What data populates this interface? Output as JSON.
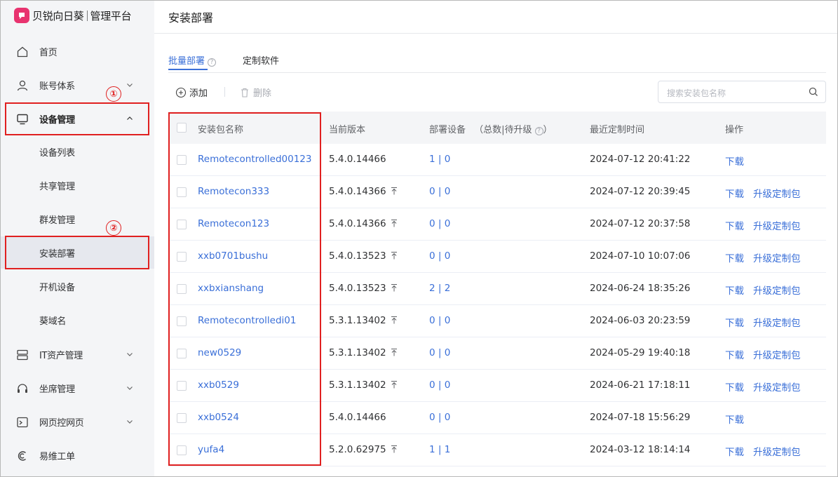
{
  "colors": {
    "accent": "#3a6fd8",
    "brand": "#e8336f",
    "annotation": "#e02020"
  },
  "logo": {
    "brand": "贝锐向日葵",
    "product": "管理平台"
  },
  "sidebar": {
    "items": [
      {
        "label": "首页",
        "icon": "home-icon"
      },
      {
        "label": "账号体系",
        "icon": "user-icon"
      },
      {
        "label": "设备管理",
        "icon": "monitor-icon"
      },
      {
        "label": "IT资产管理",
        "icon": "server-icon"
      },
      {
        "label": "坐席管理",
        "icon": "headset-icon"
      },
      {
        "label": "网页控网页",
        "icon": "terminal-icon"
      },
      {
        "label": "易维工单",
        "icon": "ticket-icon"
      }
    ],
    "device_sub": [
      "设备列表",
      "共享管理",
      "群发管理",
      "安装部署",
      "开机设备",
      "葵域名"
    ]
  },
  "annotations": {
    "first": "①",
    "second": "②"
  },
  "header": {
    "title": "安装部署"
  },
  "tabs": [
    {
      "label": "批量部署",
      "help": "?"
    },
    {
      "label": "定制软件"
    }
  ],
  "toolbar": {
    "add": "添加",
    "delete": "删除",
    "search_placeholder": "搜索安装包名称"
  },
  "table": {
    "headers": {
      "name": "安装包名称",
      "version": "当前版本",
      "devices": "部署设备",
      "devices_hint": "（总数|待升级",
      "devices_hint_end": "）",
      "help": "?",
      "time": "最近定制时间",
      "action": "操作"
    },
    "rows": [
      {
        "name": "Remotecontrolled00123",
        "version": "5.4.0.14466",
        "upgradable": false,
        "devices": "1 | 0",
        "time": "2024-07-12 20:41:22",
        "download": "下载",
        "upgrade": ""
      },
      {
        "name": "Remotecon333",
        "version": "5.4.0.14366",
        "upgradable": true,
        "devices": "0 | 0",
        "time": "2024-07-12 20:39:45",
        "download": "下载",
        "upgrade": "升级定制包"
      },
      {
        "name": "Remotecon123",
        "version": "5.4.0.14366",
        "upgradable": true,
        "devices": "0 | 0",
        "time": "2024-07-12 20:37:58",
        "download": "下载",
        "upgrade": "升级定制包"
      },
      {
        "name": "xxb0701bushu",
        "version": "5.4.0.13523",
        "upgradable": true,
        "devices": "0 | 0",
        "time": "2024-07-10 10:07:06",
        "download": "下载",
        "upgrade": "升级定制包"
      },
      {
        "name": "xxbxianshang",
        "version": "5.4.0.13523",
        "upgradable": true,
        "devices": "2 | 2",
        "time": "2024-06-24 18:35:26",
        "download": "下载",
        "upgrade": "升级定制包"
      },
      {
        "name": "Remotecontrolledi01",
        "version": "5.3.1.13402",
        "upgradable": true,
        "devices": "0 | 0",
        "time": "2024-06-03 20:23:59",
        "download": "下载",
        "upgrade": "升级定制包"
      },
      {
        "name": "new0529",
        "version": "5.3.1.13402",
        "upgradable": true,
        "devices": "0 | 0",
        "time": "2024-05-29 19:40:18",
        "download": "下载",
        "upgrade": "升级定制包"
      },
      {
        "name": "xxb0529",
        "version": "5.3.1.13402",
        "upgradable": true,
        "devices": "0 | 0",
        "time": "2024-06-21 17:18:11",
        "download": "下载",
        "upgrade": "升级定制包"
      },
      {
        "name": "xxb0524",
        "version": "5.4.0.14466",
        "upgradable": false,
        "devices": "0 | 0",
        "time": "2024-07-18 15:56:29",
        "download": "下载",
        "upgrade": ""
      },
      {
        "name": "yufa4",
        "version": "5.2.0.62975",
        "upgradable": true,
        "devices": "1 | 1",
        "time": "2024-03-12 18:14:14",
        "download": "下载",
        "upgrade": "升级定制包"
      }
    ]
  }
}
